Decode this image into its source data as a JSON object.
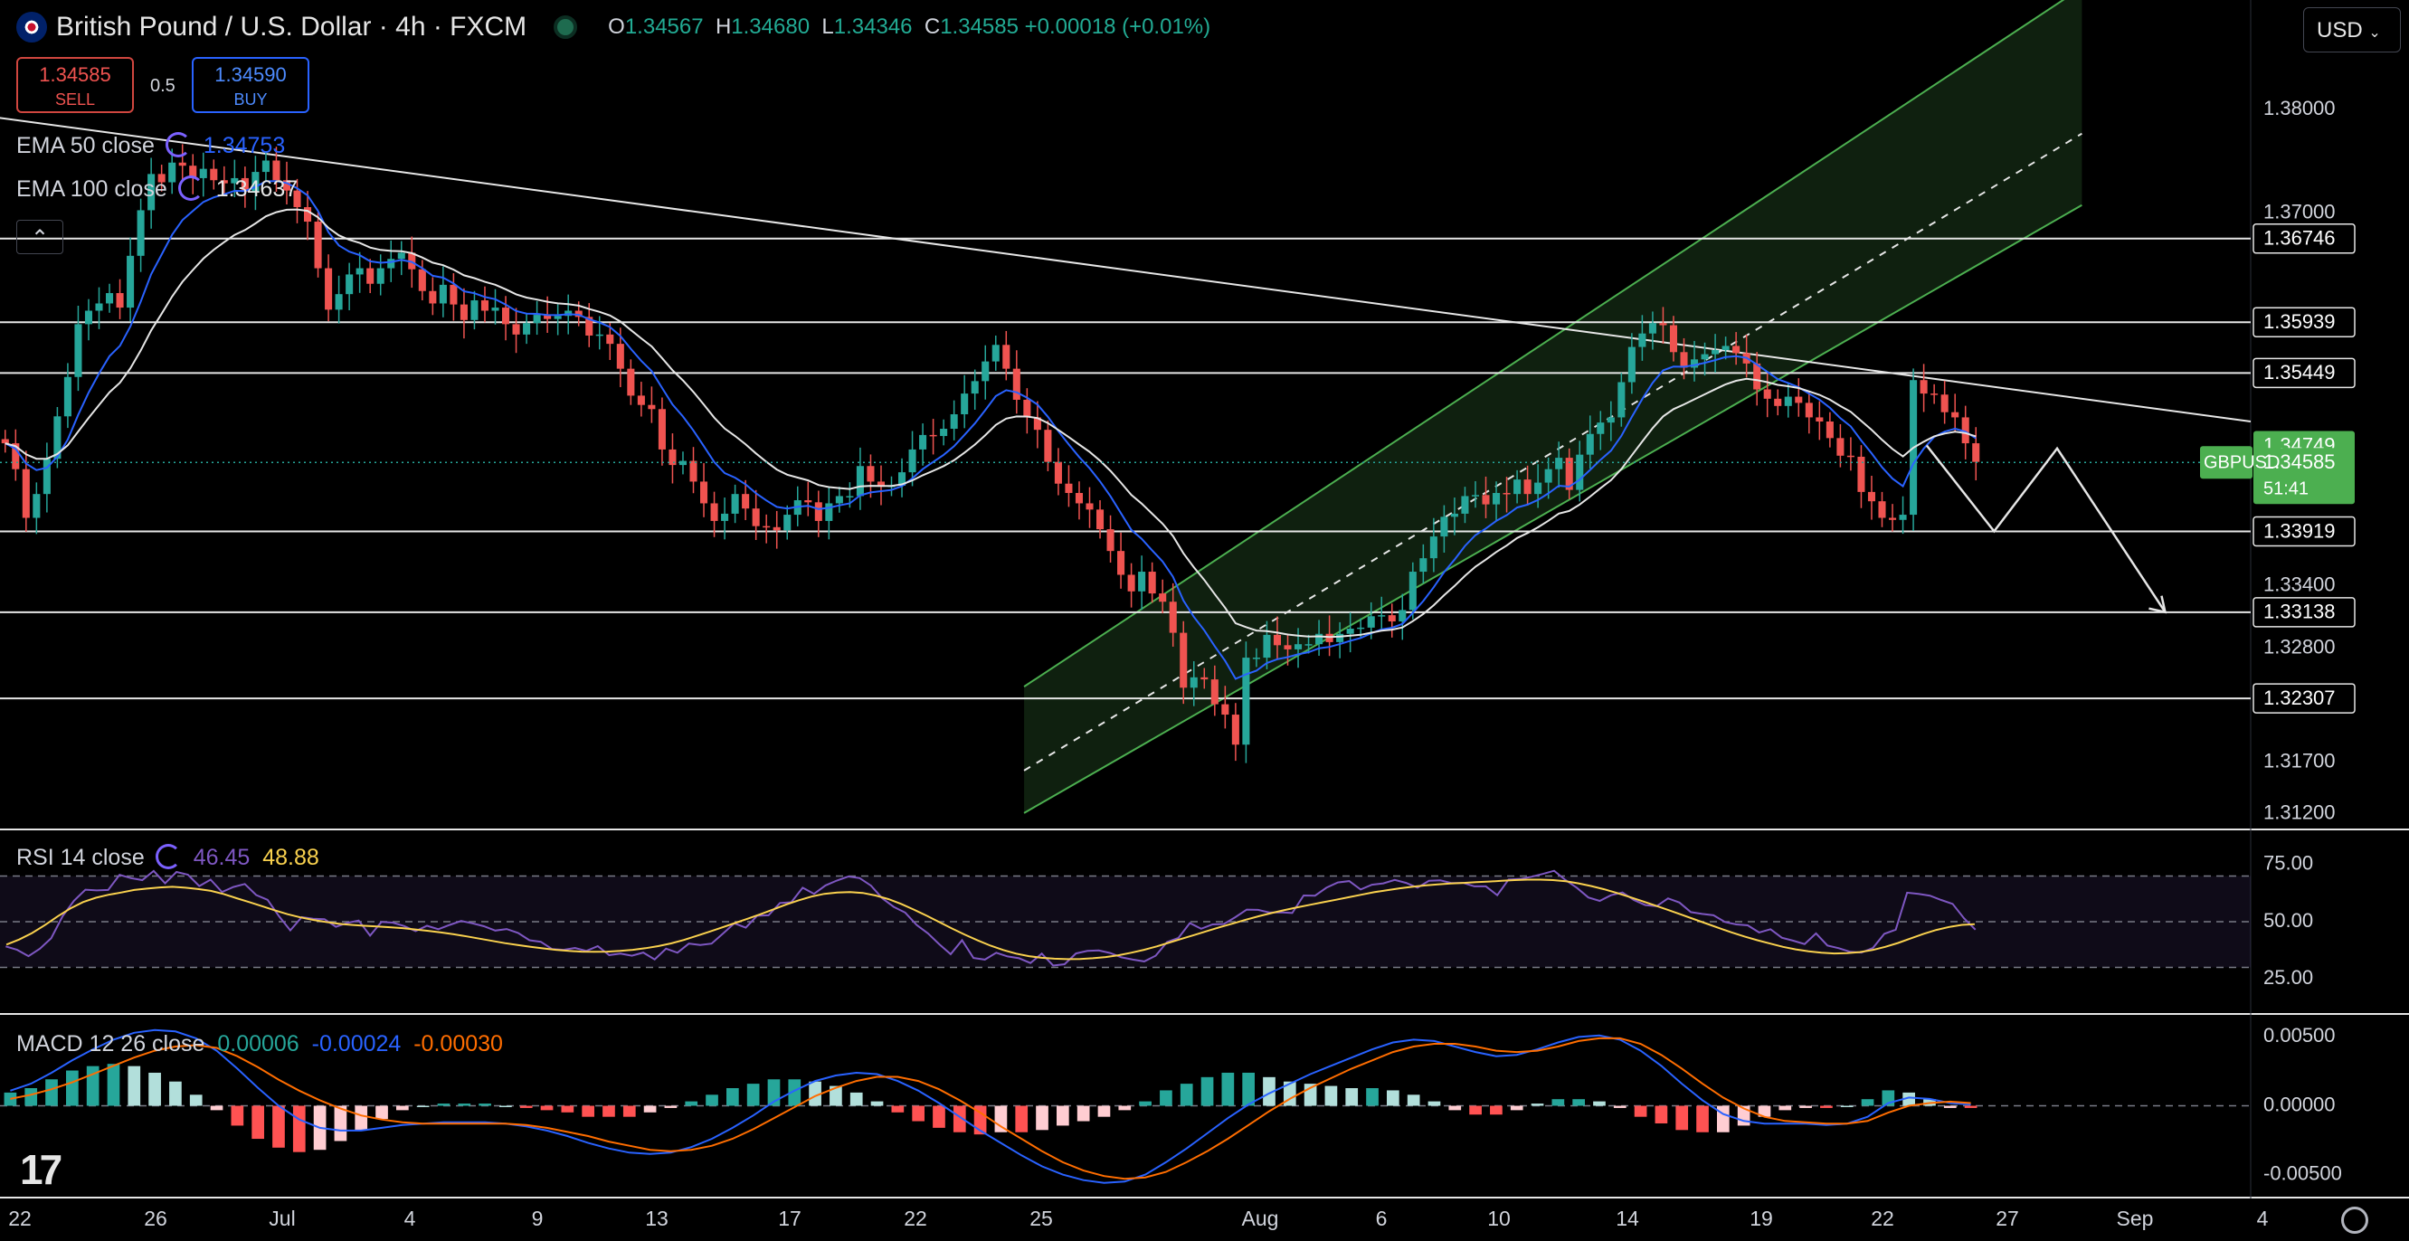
{
  "header": {
    "title": "British Pound / U.S. Dollar · 4h · FXCM",
    "ohlc": [
      {
        "k": "O",
        "v": "1.34567"
      },
      {
        "k": "H",
        "v": "1.34680"
      },
      {
        "k": "L",
        "v": "1.34346"
      },
      {
        "k": "C",
        "v": "1.34585"
      }
    ],
    "change": "+0.00018 (+0.01%)"
  },
  "trade": {
    "sell_price": "1.34585",
    "sell_label": "SELL",
    "spread": "0.5",
    "buy_price": "1.34590",
    "buy_label": "BUY"
  },
  "legend": {
    "ema50_label": "EMA 50 close",
    "ema50_value": "1.34753",
    "ema100_label": "EMA 100 close",
    "ema100_value": "1.34637",
    "collapse_icon": "chevron-up-icon"
  },
  "currency_selector": "USD",
  "colors": {
    "up": "#26a69a",
    "down": "#ef5350",
    "ema50": "#2962ff",
    "ema100": "#e6e6e6",
    "channel": "#4caf50",
    "rsi": "#7e57c2",
    "rsi_ma": "#f9d14e",
    "macd": "#2962ff",
    "signal": "#ff6d00",
    "last_price_badge": "#4caf50"
  },
  "chart_data": [
    {
      "type": "candlestick",
      "symbol": "GBPUSD",
      "y_range": [
        1.3105,
        1.3905
      ],
      "y_ticks": [
        "1.38000",
        "1.37000",
        "1.36746",
        "1.35939",
        "1.35449",
        "1.34749",
        "1.34585",
        "1.33919",
        "1.33400",
        "1.33138",
        "1.32800",
        "1.32307",
        "1.31700",
        "1.31200"
      ],
      "x_ticks": [
        "22",
        "26",
        "Jul",
        "4",
        "9",
        "13",
        "17",
        "22",
        "25",
        "Aug",
        "6",
        "10",
        "14",
        "19",
        "22",
        "27",
        "Sep",
        "4"
      ],
      "last_price": {
        "label": "GBPUSD",
        "value": "1.34585",
        "countdown": "51:41"
      },
      "ema_badge": "1.34749",
      "horizontal_levels": [
        1.36746,
        1.35939,
        1.35449,
        1.33919,
        1.33138,
        1.32307
      ],
      "trendline": {
        "from": [
          -0.02,
          1.3797
        ],
        "to": [
          1.0,
          1.3498
        ]
      },
      "channel": {
        "x_range": [
          0.455,
          0.925
        ],
        "lower": [
          1.312,
          1.3707
        ],
        "mid": [
          1.3161,
          1.3776
        ],
        "upper": [
          1.3242,
          1.3917
        ]
      },
      "projection": [
        [
          0.856,
          1.3475
        ],
        [
          0.886,
          1.3392
        ],
        [
          0.914,
          1.3472
        ],
        [
          0.962,
          1.3314
        ]
      ],
      "close": [
        1.3477,
        1.3452,
        1.3405,
        1.3428,
        1.3462,
        1.3503,
        1.3541,
        1.3592,
        1.3605,
        1.3612,
        1.3622,
        1.3608,
        1.3658,
        1.3702,
        1.3737,
        1.3729,
        1.3748,
        1.3745,
        1.3733,
        1.3742,
        1.3731,
        1.3728,
        1.3733,
        1.372,
        1.3739,
        1.375,
        1.3731,
        1.3721,
        1.3705,
        1.3691,
        1.3646,
        1.3606,
        1.3621,
        1.364,
        1.3646,
        1.3631,
        1.3646,
        1.3655,
        1.3661,
        1.3645,
        1.3624,
        1.3612,
        1.363,
        1.3611,
        1.3596,
        1.3615,
        1.3605,
        1.3608,
        1.3592,
        1.3582,
        1.3593,
        1.3601,
        1.3597,
        1.36,
        1.3605,
        1.3599,
        1.3581,
        1.3582,
        1.3573,
        1.3549,
        1.3523,
        1.3514,
        1.351,
        1.3471,
        1.3456,
        1.346,
        1.344,
        1.3419,
        1.3402,
        1.3409,
        1.3428,
        1.3414,
        1.3397,
        1.3396,
        1.3393,
        1.3408,
        1.3422,
        1.342,
        1.3402,
        1.3419,
        1.3426,
        1.3426,
        1.3455,
        1.344,
        1.3435,
        1.3436,
        1.3449,
        1.3471,
        1.3485,
        1.3484,
        1.3491,
        1.3505,
        1.3525,
        1.3537,
        1.3556,
        1.3572,
        1.3549,
        1.3519,
        1.3502,
        1.349,
        1.3459,
        1.3438,
        1.3429,
        1.3419,
        1.3413,
        1.3394,
        1.3373,
        1.335,
        1.3334,
        1.3353,
        1.3332,
        1.3324,
        1.3294,
        1.3241,
        1.3251,
        1.3249,
        1.3225,
        1.3215,
        1.3186,
        1.327,
        1.327,
        1.3292,
        1.3282,
        1.3278,
        1.3283,
        1.3283,
        1.3293,
        1.3285,
        1.3293,
        1.3298,
        1.3299,
        1.331,
        1.3311,
        1.3305,
        1.3316,
        1.3353,
        1.3366,
        1.3387,
        1.3406,
        1.3409,
        1.3426,
        1.3427,
        1.3418,
        1.3429,
        1.3428,
        1.3442,
        1.3428,
        1.3439,
        1.3452,
        1.3463,
        1.3432,
        1.3466,
        1.3486,
        1.3497,
        1.3502,
        1.3536,
        1.357,
        1.3583,
        1.3593,
        1.3591,
        1.3565,
        1.355,
        1.3558,
        1.3563,
        1.3567,
        1.3571,
        1.3564,
        1.3554,
        1.3529,
        1.352,
        1.3513,
        1.3522,
        1.3516,
        1.3502,
        1.3498,
        1.3482,
        1.3465,
        1.3464,
        1.343,
        1.3421,
        1.3405,
        1.3403,
        1.3408,
        1.3538,
        1.3525,
        1.3524,
        1.3507,
        1.3502,
        1.3477,
        1.3459
      ]
    },
    {
      "type": "line",
      "title": "RSI 14 close",
      "values_printed": [
        "46.45",
        "48.88"
      ],
      "y_ticks": [
        "75.00",
        "50.00",
        "25.00"
      ],
      "y_range": [
        10,
        90
      ],
      "rsi": [
        39.2,
        37.7,
        34.9,
        38.2,
        42.8,
        52.4,
        59.2,
        64.0,
        63.7,
        63.9,
        70.5,
        69.1,
        68.2,
        72.2,
        66.8,
        71.8,
        70.6,
        65.6,
        68.4,
        63.0,
        65.2,
        66.5,
        61.7,
        59.6,
        52.4,
        46.2,
        52.0,
        51.3,
        51.1,
        47.8,
        49.5,
        50.5,
        43.9,
        49.9,
        49.6,
        48.1,
        45.9,
        48.2,
        46.7,
        48.6,
        50.3,
        49.3,
        48.0,
        46.1,
        46.8,
        45.1,
        41.9,
        41.2,
        38.0,
        37.7,
        38.5,
        37.2,
        39.3,
        35.4,
        36.0,
        35.1,
        36.5,
        33.5,
        38.2,
        36.4,
        40.4,
        39.8,
        40.4,
        44.8,
        49.3,
        47.4,
        52.6,
        52.8,
        58.2,
        58.5,
        64.9,
        62.2,
        65.9,
        68.0,
        69.8,
        69.1,
        65.8,
        60.2,
        56.5,
        54.0,
        48.6,
        44.9,
        40.1,
        35.8,
        41.9,
        34.1,
        33.4,
        36.4,
        34.8,
        34.0,
        31.9,
        36.0,
        30.8,
        31.4,
        36.1,
        37.2,
        37.4,
        36.3,
        34.4,
        33.4,
        32.6,
        35.1,
        41.1,
        42.9,
        49.4,
        46.9,
        48.8,
        49.0,
        52.0,
        55.3,
        55.2,
        54.0,
        54.1,
        53.8,
        61.5,
        61.4,
        64.9,
        67.2,
        67.8,
        64.1,
        66.2,
        66.8,
        68.3,
        67.0,
        64.9,
        67.9,
        68.1,
        66.9,
        67.0,
        65.5,
        65.5,
        61.6,
        68.5,
        68.7,
        69.7,
        70.9,
        72.3,
        68.2,
        64.8,
        60.6,
        59.1,
        61.6,
        62.8,
        59.5,
        57.3,
        56.8,
        60.2,
        58.4,
        54.2,
        53.4,
        52.8,
        49.9,
        48.8,
        48.4,
        45.3,
        46.7,
        43.0,
        41.7,
        40.2,
        44.9,
        39.6,
        38.4,
        36.8,
        36.5,
        38.5,
        44.7,
        46.5,
        62.7,
        62.2,
        61.4,
        59.5,
        57.8,
        51.5,
        46.5
      ],
      "rsi_ma": [
        40.0,
        42.2,
        45.0,
        48.5,
        52.3,
        55.8,
        58.6,
        60.5,
        61.8,
        62.8,
        63.9,
        64.5,
        65.0,
        65.3,
        64.9,
        64.3,
        63.5,
        62.1,
        60.3,
        58.6,
        56.8,
        55.0,
        53.3,
        51.9,
        50.8,
        49.9,
        49.1,
        48.6,
        48.2,
        47.9,
        47.6,
        47.2,
        46.6,
        46.0,
        45.3,
        44.5,
        43.6,
        42.6,
        41.6,
        40.6,
        39.8,
        39.0,
        38.3,
        37.7,
        37.2,
        36.9,
        36.8,
        36.9,
        37.2,
        37.7,
        38.4,
        39.3,
        40.5,
        42.0,
        43.8,
        45.6,
        47.5,
        49.4,
        51.3,
        53.3,
        55.4,
        57.5,
        59.4,
        61.0,
        62.2,
        62.8,
        63.0,
        62.6,
        61.5,
        59.9,
        57.8,
        55.3,
        52.6,
        49.8,
        47.0,
        44.3,
        41.8,
        39.5,
        37.6,
        36.0,
        34.9,
        34.2,
        33.8,
        33.6,
        33.7,
        34.0,
        34.5,
        35.3,
        36.4,
        37.7,
        39.2,
        40.9,
        42.6,
        44.3,
        46.0,
        47.7,
        49.3,
        50.9,
        52.4,
        53.8,
        55.1,
        56.3,
        57.4,
        58.5,
        59.6,
        60.7,
        61.8,
        62.9,
        63.8,
        64.6,
        65.3,
        65.9,
        66.3,
        66.7,
        67.0,
        67.3,
        67.6,
        67.9,
        68.2,
        68.4,
        68.4,
        68.2,
        67.7,
        66.8,
        65.6,
        64.2,
        62.6,
        60.8,
        59.0,
        57.1,
        55.2,
        53.2,
        51.2,
        49.2,
        47.2,
        45.3,
        43.5,
        41.9,
        40.4,
        39.0,
        37.9,
        37.0,
        36.4,
        36.1,
        36.2,
        36.7,
        37.6,
        39.0,
        40.7,
        42.7,
        44.7,
        46.4,
        47.7,
        48.6,
        48.9
      ]
    },
    {
      "type": "line",
      "title": "MACD 12 26 close",
      "values_printed": [
        "0.00006",
        "-0.00024",
        "-0.00030"
      ],
      "y_ticks": [
        "0.00500",
        "0.00000",
        "-0.00500"
      ],
      "y_range": [
        -0.0066,
        0.0066
      ],
      "macd": [
        0.0011,
        0.0016,
        0.0024,
        0.0033,
        0.0041,
        0.0048,
        0.0053,
        0.0055,
        0.0054,
        0.0049,
        0.004,
        0.0027,
        0.0013,
        0.0,
        -0.001,
        -0.0016,
        -0.0018,
        -0.0018,
        -0.0016,
        -0.0014,
        -0.0013,
        -0.0012,
        -0.0012,
        -0.0012,
        -0.0013,
        -0.0015,
        -0.0018,
        -0.0022,
        -0.0027,
        -0.0031,
        -0.0034,
        -0.0035,
        -0.0034,
        -0.003,
        -0.0024,
        -0.0016,
        -0.0007,
        0.0003,
        0.0011,
        0.0018,
        0.0022,
        0.0024,
        0.0023,
        0.0018,
        0.0011,
        0.0002,
        -0.0008,
        -0.0018,
        -0.0027,
        -0.0036,
        -0.0044,
        -0.005,
        -0.0054,
        -0.0056,
        -0.0055,
        -0.005,
        -0.0041,
        -0.0031,
        -0.002,
        -0.0009,
        0.0001,
        0.0009,
        0.0016,
        0.0023,
        0.0029,
        0.0035,
        0.0041,
        0.0046,
        0.0048,
        0.0047,
        0.0043,
        0.0039,
        0.0036,
        0.0037,
        0.0041,
        0.0046,
        0.005,
        0.0051,
        0.0048,
        0.004,
        0.0029,
        0.0016,
        0.0004,
        -0.0006,
        -0.0011,
        -0.0013,
        -0.0013,
        -0.0013,
        -0.0014,
        -0.0013,
        -0.0008,
        0.0002,
        0.0006,
        0.0005,
        0.0002,
        0.0001
      ],
      "signal": [
        0.0005,
        0.0008,
        0.0012,
        0.0017,
        0.0023,
        0.0029,
        0.0035,
        0.004,
        0.0043,
        0.0044,
        0.0042,
        0.0036,
        0.0028,
        0.0019,
        0.0011,
        0.0004,
        -0.0002,
        -0.0007,
        -0.001,
        -0.0012,
        -0.0013,
        -0.0013,
        -0.0013,
        -0.0013,
        -0.0013,
        -0.0014,
        -0.0016,
        -0.0019,
        -0.0022,
        -0.0026,
        -0.0029,
        -0.0032,
        -0.0033,
        -0.0032,
        -0.0029,
        -0.0024,
        -0.0017,
        -0.0009,
        -0.0001,
        0.0007,
        0.0013,
        0.0018,
        0.0021,
        0.0021,
        0.0018,
        0.0012,
        0.0004,
        -0.0005,
        -0.0015,
        -0.0024,
        -0.0033,
        -0.0041,
        -0.0047,
        -0.0051,
        -0.0053,
        -0.0052,
        -0.0048,
        -0.0041,
        -0.0033,
        -0.0024,
        -0.0014,
        -0.0004,
        0.0005,
        0.0013,
        0.002,
        0.0027,
        0.0033,
        0.0039,
        0.0043,
        0.0045,
        0.0045,
        0.0043,
        0.004,
        0.0039,
        0.004,
        0.0043,
        0.0047,
        0.0049,
        0.0049,
        0.0045,
        0.0037,
        0.0027,
        0.0016,
        0.0006,
        -0.0002,
        -0.0008,
        -0.0011,
        -0.0012,
        -0.0013,
        -0.0013,
        -0.0011,
        -0.0005,
        0.0,
        0.0002,
        0.0003,
        0.0002
      ]
    }
  ]
}
